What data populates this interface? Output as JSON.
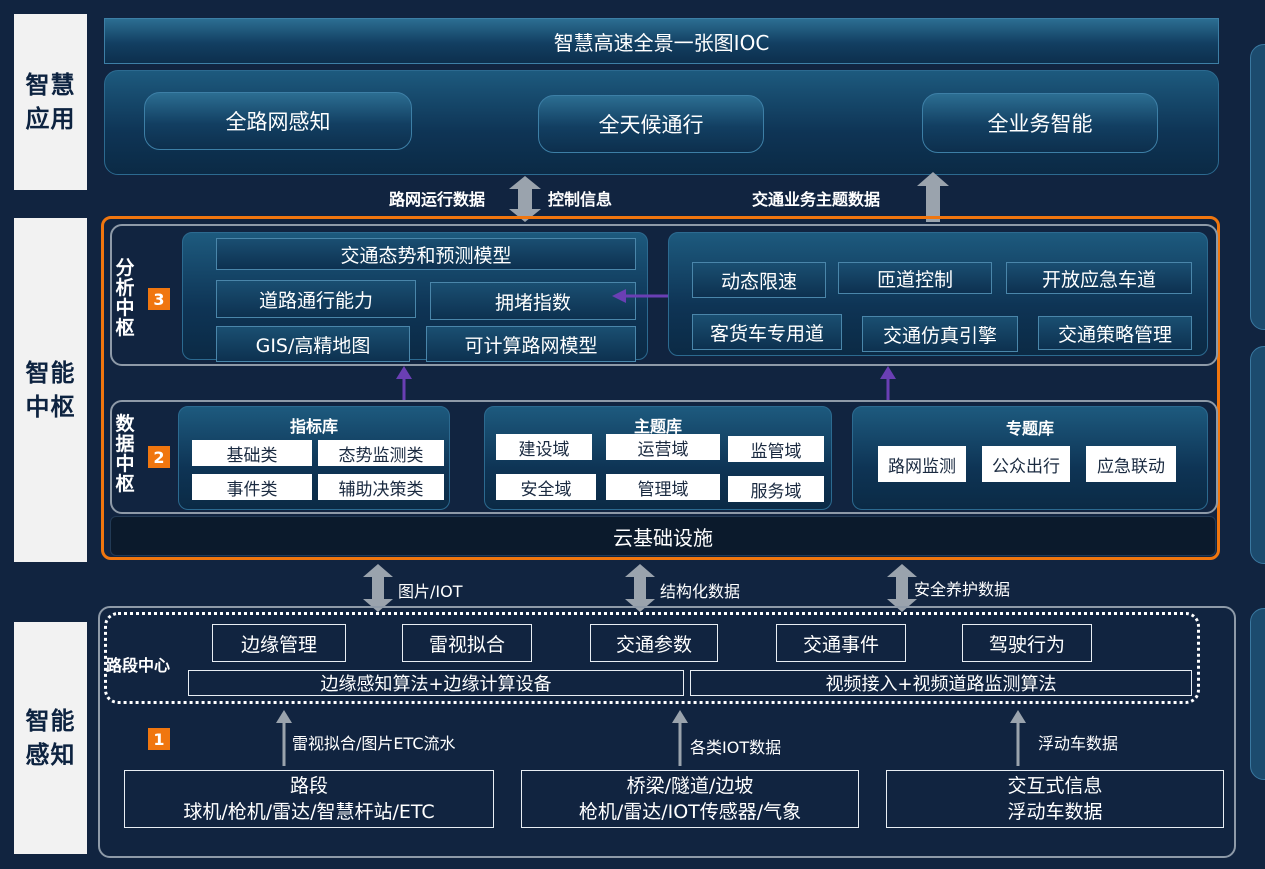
{
  "side_labels": {
    "app": [
      "智慧",
      "应用"
    ],
    "hub": [
      "智能",
      "中枢"
    ],
    "perception": [
      "智能",
      "感知"
    ]
  },
  "top_banner": "智慧高速全景一张图IOC",
  "apps": [
    "全路网感知",
    "全天候通行",
    "全业务智能"
  ],
  "flows_top": {
    "left_a": "路网运行数据",
    "left_b": "控制信息",
    "right": "交通业务主题数据"
  },
  "analysis_hub": {
    "title": [
      "分",
      "析",
      "中",
      "枢"
    ],
    "badge": "3",
    "models": {
      "top": "交通态势和预测模型",
      "road_capacity": "道路通行能力",
      "congestion": "拥堵指数",
      "gis": "GIS/高精地图",
      "network_model": "可计算路网模型"
    },
    "controls": [
      "动态限速",
      "匝道控制",
      "开放应急车道",
      "客货车专用道",
      "交通仿真引擎",
      "交通策略管理"
    ]
  },
  "data_hub": {
    "title": [
      "数",
      "据",
      "中",
      "枢"
    ],
    "badge": "2",
    "index_lib": {
      "title": "指标库",
      "items": [
        "基础类",
        "态势监测类",
        "事件类",
        "辅助决策类"
      ]
    },
    "theme_lib": {
      "title": "主题库",
      "items": [
        "建设域",
        "运营域",
        "监管域",
        "安全域",
        "管理域",
        "服务域"
      ]
    },
    "topic_lib": {
      "title": "专题库",
      "items": [
        "路网监测",
        "公众出行",
        "应急联动"
      ]
    }
  },
  "cloud": "云基础设施",
  "flows_mid": [
    "图片/IOT",
    "结构化数据",
    "安全养护数据"
  ],
  "segment_center": {
    "label": "路段中心",
    "items": [
      "边缘管理",
      "雷视拟合",
      "交通参数",
      "交通事件",
      "驾驶行为"
    ],
    "bar_left": "边缘感知算法+边缘计算设备",
    "bar_right": "视频接入+视频道路监测算法"
  },
  "perception_badge": "1",
  "flows_bottom": [
    "雷视拟合/图片ETC流水",
    "各类IOT数据",
    "浮动车数据"
  ],
  "sources": [
    {
      "line1": "路段",
      "line2": "球机/枪机/雷达/智慧杆站/ETC"
    },
    {
      "line1": "桥梁/隧道/边坡",
      "line2": "枪机/雷达/IOT传感器/气象"
    },
    {
      "line1": "交互式信息",
      "line2": "浮动车数据"
    }
  ],
  "colors": {
    "background": "#112440",
    "accent_orange": "#f0760f",
    "arrow_purple": "#6a3fb4",
    "arrow_gray": "#9aa3ad"
  }
}
